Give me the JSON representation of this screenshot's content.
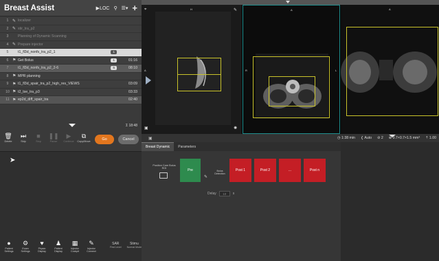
{
  "app": {
    "title": "Breast Assist",
    "loc_label": "LOC"
  },
  "protocol_rows": [
    {
      "num": "1",
      "icon": "wrench",
      "name": "localizer",
      "tag": "",
      "time": "",
      "state": "dim"
    },
    {
      "num": "2",
      "icon": "wrench",
      "name": "stir_tra_p2",
      "tag": "",
      "time": "",
      "state": "dim"
    },
    {
      "num": "3",
      "icon": "",
      "name": "Planning of Dynamic Scanning",
      "tag": "",
      "time": "",
      "state": "dim"
    },
    {
      "num": "4",
      "icon": "wrench",
      "name": "Prepare injector",
      "tag": "",
      "time": "",
      "state": "dim"
    },
    {
      "num": "5",
      "icon": "",
      "name": "t1_fl3d_nonfs_tra_p2_1",
      "tag": "1",
      "time": "",
      "state": "active"
    },
    {
      "num": "6",
      "icon": "runner",
      "name": "Get Bolus",
      "tag": "1",
      "time": "01:16",
      "state": "normal"
    },
    {
      "num": "7",
      "icon": "",
      "name": "t1_fl3d_nonfs_tra_p2_2-6",
      "tag": "5",
      "time": "08:10",
      "state": "sel"
    },
    {
      "num": "8",
      "icon": "runner",
      "name": "MPR planning",
      "tag": "",
      "time": "",
      "state": "normal"
    },
    {
      "num": "9",
      "icon": "runner",
      "name": "t1_fl3d_spair_tra_p2_high_res_VIEWS",
      "tag": "",
      "time": "03:09",
      "state": "normal"
    },
    {
      "num": "10",
      "icon": "runner",
      "name": "t2_tse_tra_p3",
      "tag": "",
      "time": "03:33",
      "state": "normal"
    },
    {
      "num": "11",
      "icon": "runner",
      "name": "ep2d_diff_spair_tra",
      "tag": "",
      "time": "02:40",
      "state": "sel2"
    }
  ],
  "timeline": {
    "total": "Σ 18:48"
  },
  "toolbar": {
    "delete": "Delete",
    "skip": "Skip",
    "stop": "Stop",
    "pause": "Pause",
    "continue": "Continue",
    "copy_move": "Copy/Move",
    "go": "Go",
    "cancel": "Cancel"
  },
  "bottom_icons": [
    {
      "label": "Patient Settings"
    },
    {
      "label": "Exam Settings"
    },
    {
      "label": "Physio Display"
    },
    {
      "label": "Patient Display"
    },
    {
      "label": "Injector Cockpit"
    },
    {
      "label": "Injector Connect"
    }
  ],
  "sar": {
    "sar": "SAR",
    "stimu": "Stimu",
    "level": "First Level",
    "mode": "Normal Mode"
  },
  "viewer": {
    "seg1_top": "H",
    "seg2_top": "A",
    "seg3_top": "A",
    "seg1_left": "A",
    "seg2_left": "R",
    "seg2_right": "L"
  },
  "status": {
    "time": "1:38 min",
    "auto": "Auto",
    "count": "2",
    "voxel": "0.7×0.7×1.5 mm³",
    "ratio": "1.00"
  },
  "tabs": [
    "Breast Dynamic",
    "Parameters"
  ],
  "dynamic": {
    "position_label": "Position Care Bolus ROI",
    "pre": "Pre",
    "bolus_label": "Bolus Detection",
    "post1": "Post 1",
    "post2": "Post 2",
    "dots": "...",
    "postn": "Post n",
    "delay_label": "Delay",
    "delay_value": "10",
    "delay_unit": "s"
  },
  "colors": {
    "go": "#e2761e",
    "pre": "#2e8b4e",
    "post": "#c41e25",
    "roi": "#c9c32a",
    "active_frame": "#1f8f8f"
  }
}
